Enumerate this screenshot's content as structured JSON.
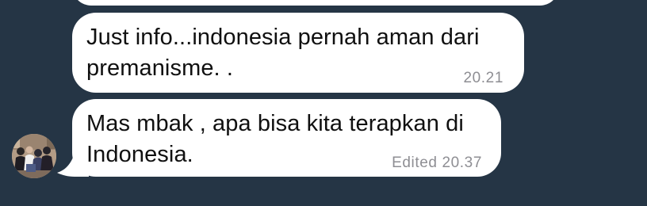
{
  "messages": [
    {
      "text": "Just info...indonesia pernah aman dari premanisme. .",
      "time": "20.21"
    },
    {
      "text": "Mas mbak , apa bisa kita terapkan di Indonesia.",
      "time": "Edited 20.37"
    }
  ],
  "colors": {
    "background": "#253545",
    "bubble": "#ffffff",
    "text": "#101010",
    "meta": "#8e8e93"
  },
  "icons": {
    "avatar": "group-photo-avatar"
  }
}
